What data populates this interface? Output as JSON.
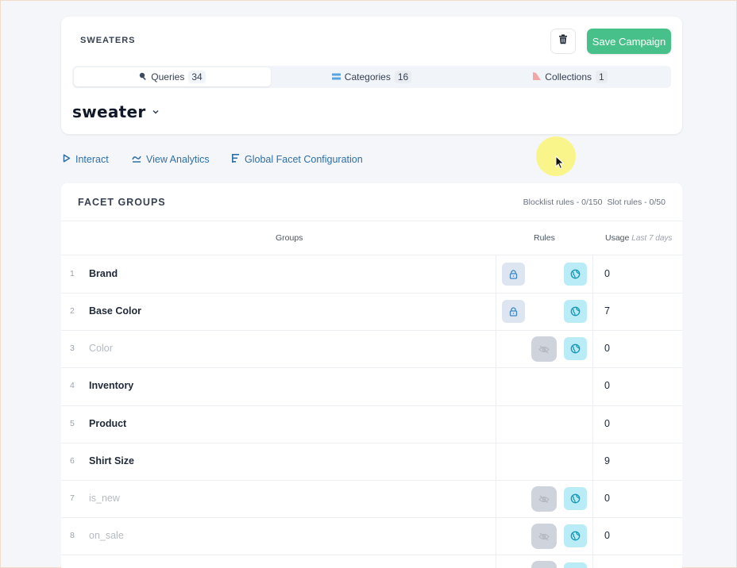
{
  "campaign": {
    "label": "SWEATERS",
    "save_label": "Save Campaign",
    "tabs": [
      {
        "label": "Queries",
        "count": "34",
        "icon": "search-icon",
        "active": true
      },
      {
        "label": "Categories",
        "count": "16",
        "icon": "list-icon",
        "active": false
      },
      {
        "label": "Collections",
        "count": "1",
        "icon": "collection-icon",
        "active": false
      }
    ],
    "query": "sweater"
  },
  "actions": {
    "interact": "Interact",
    "analytics": "View Analytics",
    "global_facet": "Global Facet Configuration"
  },
  "facets": {
    "title": "FACET GROUPS",
    "blocklist": "Blocklist rules - 0/150",
    "slot": "Slot rules - 0/50",
    "columns": {
      "groups": "Groups",
      "rules": "Rules",
      "usage": "Usage",
      "usage_period": "Last 7 days"
    },
    "rows": [
      {
        "num": "1",
        "name": "Brand",
        "usage": "0"
      },
      {
        "num": "2",
        "name": "Base Color",
        "usage": "7"
      },
      {
        "num": "3",
        "name": "Color",
        "usage": "0"
      },
      {
        "num": "4",
        "name": "Inventory",
        "usage": "0"
      },
      {
        "num": "5",
        "name": "Product",
        "usage": "0"
      },
      {
        "num": "6",
        "name": "Shirt Size",
        "usage": "9"
      },
      {
        "num": "7",
        "name": "is_new",
        "usage": "0"
      },
      {
        "num": "8",
        "name": "on_sale",
        "usage": "0"
      }
    ]
  },
  "colors": {
    "accent_green": "#47c08a",
    "link_blue": "#2f6fa8",
    "globe_bg": "#b9ecf7",
    "lock_bg": "#dde6f0",
    "hidden_bg": "#cfd3db"
  }
}
